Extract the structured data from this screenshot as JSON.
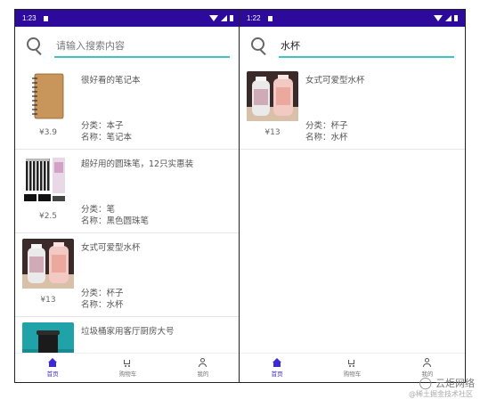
{
  "left_screen": {
    "status": {
      "time": "1:23"
    },
    "search": {
      "placeholder": "请输入搜索内容",
      "value": ""
    },
    "products": [
      {
        "title": "很好看的笔记本",
        "price": "¥3.9",
        "category": "分类：本子",
        "name": "名称：笔记本",
        "thumb": "notebook"
      },
      {
        "title": "超好用的圆珠笔，12只实惠装",
        "price": "¥2.5",
        "category": "分类：笔",
        "name": "名称：黑色圆珠笔",
        "thumb": "pens"
      },
      {
        "title": "女式可爱型水杯",
        "price": "¥13",
        "category": "分类：杯子",
        "name": "名称：水杯",
        "thumb": "cup"
      },
      {
        "title": "垃圾桶家用客厅厨房大号",
        "price": "",
        "category": "",
        "name": "",
        "thumb": "trashbin"
      }
    ],
    "nav": [
      {
        "label": "首页",
        "icon": "home-icon",
        "active": true
      },
      {
        "label": "购物车",
        "icon": "cart-icon",
        "active": false
      },
      {
        "label": "我的",
        "icon": "user-icon",
        "active": false
      }
    ]
  },
  "right_screen": {
    "status": {
      "time": "1:22"
    },
    "search": {
      "placeholder": "",
      "value": "水杯"
    },
    "products": [
      {
        "title": "女式可爱型水杯",
        "price": "¥13",
        "category": "分类：杯子",
        "name": "名称：水杯",
        "thumb": "cup"
      }
    ],
    "nav": [
      {
        "label": "首页",
        "icon": "home-icon",
        "active": true
      },
      {
        "label": "购物车",
        "icon": "cart-icon",
        "active": false
      },
      {
        "label": "我的",
        "icon": "user-icon",
        "active": false
      }
    ]
  },
  "watermark": {
    "brand": "云炬网络",
    "sub": "@稀土掘金技术社区"
  },
  "colors": {
    "status_bar": "#2d0a9b",
    "accent": "#40c4c0",
    "nav_active": "#3a2bd4"
  }
}
